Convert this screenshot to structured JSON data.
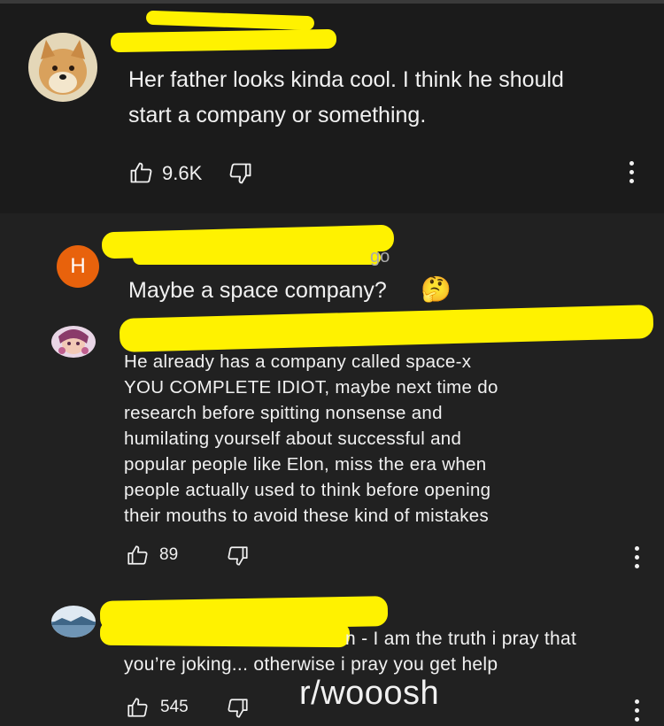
{
  "comment1": {
    "text_line1": "Her father looks kinda cool. I think he should",
    "text_line2": "start a company or something.",
    "likes": "9.6K"
  },
  "reply1": {
    "avatar_letter": "H",
    "time_fragment": "go",
    "text": "Maybe a space company?",
    "emoji": "🤔"
  },
  "reply2": {
    "lines": [
      "He already has a company called space-x",
      "YOU COMPLETE IDIOT, maybe next time do",
      "research before spitting nonsense and",
      "humilating yourself about successful and",
      "popular people like Elon, miss the era when",
      "people actually used to think before opening",
      "their mouths to avoid these kind of mistakes"
    ],
    "likes": "89"
  },
  "reply3": {
    "line1": "n - I am the truth i pray that",
    "line2": "you’re joking... otherwise i pray you get help",
    "likes": "545"
  },
  "overlay_caption": "r/wooosh",
  "colors": {
    "redaction": "#fff200",
    "avatar_h": "#e8620c",
    "background": "#212121"
  }
}
